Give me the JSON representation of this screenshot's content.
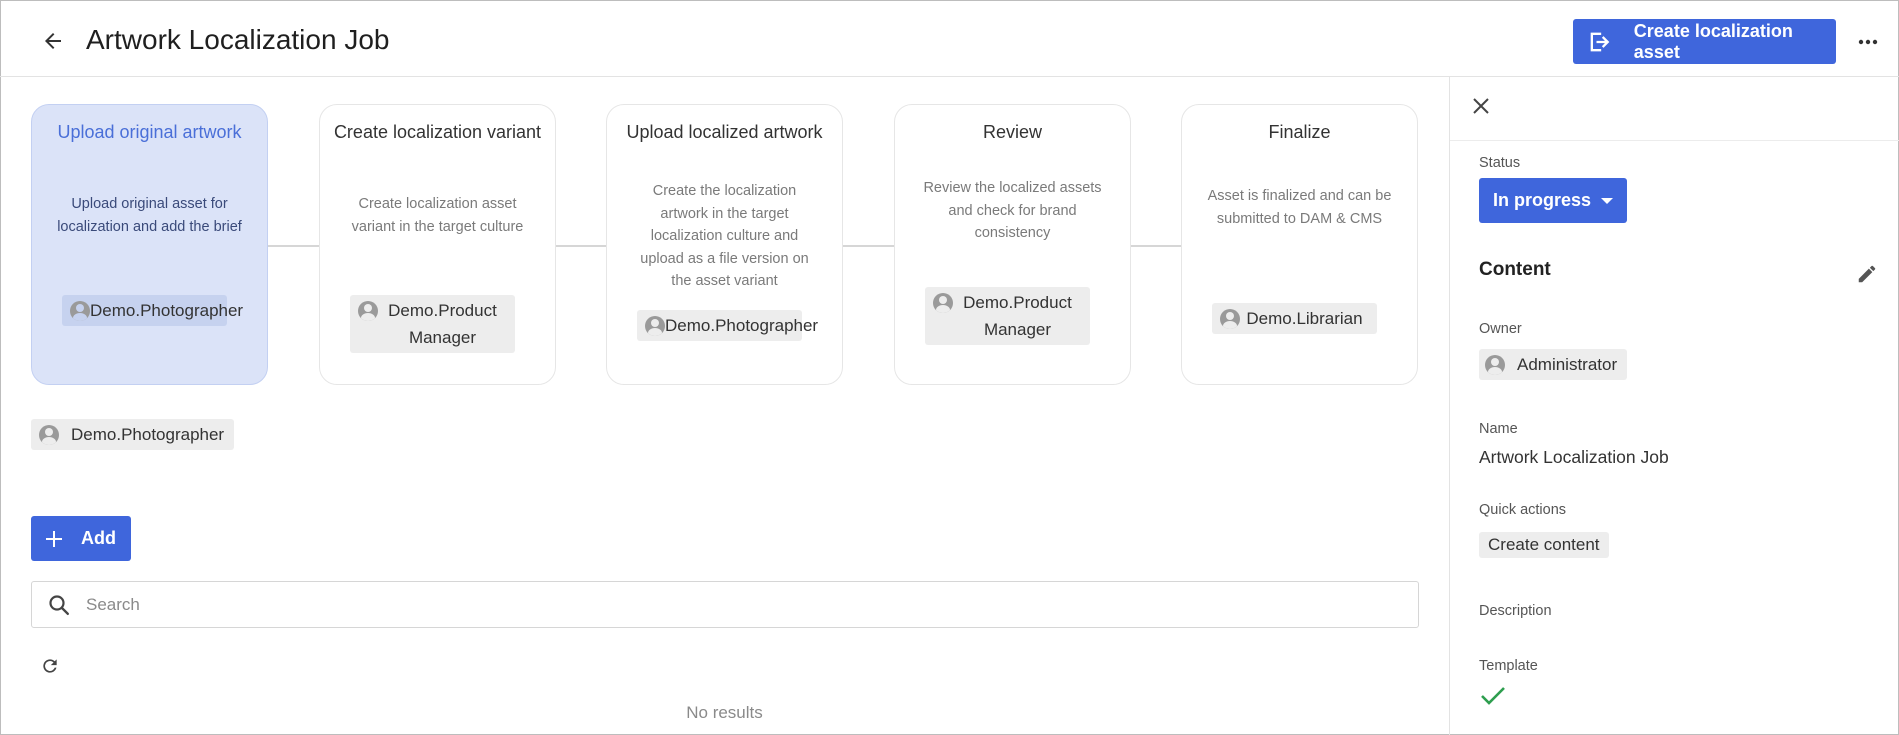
{
  "header": {
    "title": "Artwork Localization Job",
    "primary_action_label": "Create localization asset"
  },
  "steps": [
    {
      "title": "Upload original artwork",
      "description": "Upload original asset for localization and add the brief",
      "assignee": "Demo.Photographer",
      "active": true
    },
    {
      "title": "Create localization variant",
      "description": "Create localization asset variant in the target culture",
      "assignee": "Demo.Product Manager",
      "active": false
    },
    {
      "title": "Upload localized artwork",
      "description": "Create the localization artwork in the target localization culture and upload as a file version on the asset variant",
      "assignee": "Demo.Photographer",
      "active": false
    },
    {
      "title": "Review",
      "description": "Review the localized assets and check for brand consistency",
      "assignee": "Demo.Product Manager",
      "active": false
    },
    {
      "title": "Finalize",
      "description": "Asset is finalized and can be submitted to DAM & CMS",
      "assignee": "Demo.Librarian",
      "active": false
    }
  ],
  "main": {
    "assignee_chip": "Demo.Photographer",
    "add_label": "Add",
    "search_placeholder": "Search",
    "no_results": "No results"
  },
  "panel": {
    "status_label": "Status",
    "status_value": "In progress",
    "content_title": "Content",
    "owner_label": "Owner",
    "owner_value": "Administrator",
    "name_label": "Name",
    "name_value": "Artwork Localization Job",
    "quick_actions_label": "Quick actions",
    "quick_action_item": "Create content",
    "description_label": "Description",
    "template_label": "Template"
  },
  "colors": {
    "accent": "#3f66dc",
    "active_step_bg": "#dbe3f8",
    "check": "#2e9e4f"
  }
}
